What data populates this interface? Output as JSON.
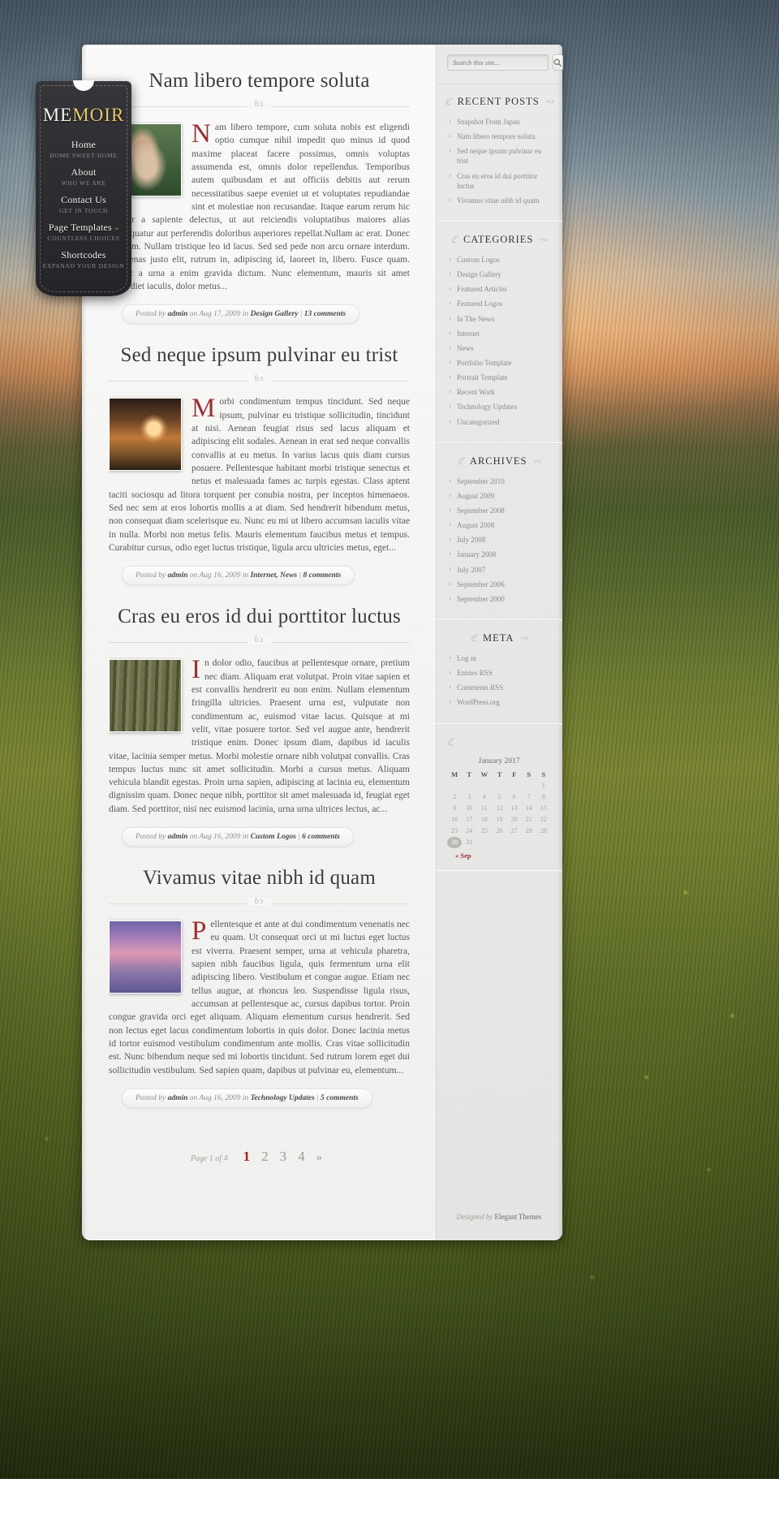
{
  "site": {
    "logo_prefix": "ME",
    "logo_suffix": "MOIR",
    "footer_credit_prefix": "Designed by ",
    "footer_credit_brand": "Elegant Themes"
  },
  "nav": [
    {
      "title": "Home",
      "sub": "HOME SWEET HOME",
      "arrow": false
    },
    {
      "title": "About",
      "sub": "WHO WE ARE",
      "arrow": false
    },
    {
      "title": "Contact Us",
      "sub": "GET IN TOUCH",
      "arrow": false
    },
    {
      "title": "Page Templates",
      "sub": "COUNTLESS CHOICES",
      "arrow": true
    },
    {
      "title": "Shortcodes",
      "sub": "EXPANAD YOUR DESIGN",
      "arrow": false
    }
  ],
  "search": {
    "placeholder": "Search this site...",
    "value": "",
    "icon": "magnifier-icon"
  },
  "posts": [
    {
      "title": "Nam libero tempore soluta",
      "divider_ornament": "ɓɔ",
      "dropcap": "N",
      "body": "am libero tempore, cum soluta nobis est eligendi optio cumque nihil impedit quo minus id quod maxime placeat facere possimus, omnis voluptas assumenda est, omnis dolor repellendus. Temporibus autem quibusdam et aut officiis debitis aut rerum necessitatibus saepe eveniet ut et voluptates repudiandae sint et molestiae non recusandae. Itaque earum rerum hic tenetur a sapiente delectus, ut aut reiciendis voluptatibus maiores alias consequatur aut perferendis doloribus asperiores repellat.Nullam ac erat. Donec a ipsum. Nullam tristique leo id lacus. Sed sed pede non arcu ornare interdum. Maecenas justo elit, rutrum in, adipiscing id, laoreet in, libero. Fusce quam. Donec a urna a enim gravida dictum. Nunc elementum, mauris sit amet imperdiet iaculis, dolor metus...",
      "meta_prefix": "Posted by ",
      "author": "admin",
      "meta_on": " on ",
      "date": "Aug 17, 2009",
      "meta_in": " in ",
      "category": "Design Gallery",
      "meta_sep": " | ",
      "comments": "13 comments",
      "thumb": "portrait-woman-forest"
    },
    {
      "title": "Sed neque ipsum pulvinar eu trist",
      "divider_ornament": "ɓɔ",
      "dropcap": "M",
      "body": "orbi condimentum tempus tincidunt. Sed neque ipsum, pulvinar eu tristique sollicitudin, tincidunt at nisi. Aenean feugiat risus sed lacus aliquam et adipiscing elit sodales. Aenean in erat sed neque convallis convallis at eu metus. In varius lacus quis diam cursus posuere. Pellentesque habitant morbi tristique senectus et netus et malesuada fames ac turpis egestas. Class aptent taciti sociosqu ad litora torquent per conubia nostra, per inceptos himenaeos. Sed nec sem at eros lobortis mollis a at diam. Sed hendrerit bibendum metus, non consequat diam scelerisque eu. Nunc eu mi ut libero accumsan iaculis vitae in nulla. Morbi non metus felis. Mauris elementum faucibus metus et tempus. Curabitur cursus, odio eget luctus tristique, ligula arcu ultricies metus, eget...",
      "meta_prefix": "Posted by ",
      "author": "admin",
      "meta_on": " on ",
      "date": "Aug 16, 2009",
      "meta_in": " in ",
      "category": "Internet, News",
      "meta_sep": " | ",
      "comments": "8 comments",
      "thumb": "sunrise-tree"
    },
    {
      "title": "Cras eu eros id dui porttitor luctus",
      "divider_ornament": "ɓɔ",
      "dropcap": "I",
      "body": "n dolor odio, faucibus at pellentesque ornare, pretium nec diam. Aliquam erat volutpat. Proin vitae sapien et est convallis hendrerit eu non enim. Nullam elementum fringilla ultricies. Praesent urna est, vulputate non condimentum ac, euismod vitae lacus. Quisque at mi velit, vitae posuere tortor. Sed vel augue ante, hendrerit tristique enim. Donec ipsum diam, dapibus id iaculis vitae, lacinia semper metus. Morbi molestie ornare nibh volutpat convallis. Cras tempus luctus nunc sit amet sollicitudin. Morbi a cursus metus. Aliquam vehicula blandit egestas. Proin urna sapien, adipiscing at lacinia eu, elementum dignissim quam. Donec neque nibh, porttitor sit amet malesuada id, feugiat eget diam. Sed porttitor, nisi nec euismod lacinia, urna urna ultrices lectus, ac...",
      "meta_prefix": "Posted by ",
      "author": "admin",
      "meta_on": " on ",
      "date": "Aug 16, 2009",
      "meta_in": " in ",
      "category": "Custom Logos",
      "meta_sep": " | ",
      "comments": "6 comments",
      "thumb": "bamboo-stalks"
    },
    {
      "title": "Vivamus vitae nibh id quam",
      "divider_ornament": "ɓɔ",
      "dropcap": "P",
      "body": "ellentesque et ante at dui condimentum venenatis nec eu quam. Ut consequat orci ut mi luctus eget luctus est viverra. Praesent semper, urna at vehicula pharetra, sapien nibh faucibus ligula, quis fermentum urna elit adipiscing libero. Vestibulum et congue augue. Etiam nec tellus augue, at rhoncus leo. Suspendisse ligula risus, accumsan at pellentesque ac, cursus dapibus tortor. Proin congue gravida orci eget aliquam. Aliquam elementum cursus hendrerit. Sed non lectus eget lacus condimentum lobortis in quis dolor. Donec lacinia metus id tortor euismod vestibulum condimentum ante mollis. Cras vitae sollicitudin est. Nunc bibendum neque sed mi lobortis tincidunt. Sed rutrum lorem eget dui sollicitudin vestibulum. Sed sapien quam, dapibus ut pulvinar eu, elementum...",
      "meta_prefix": "Posted by ",
      "author": "admin",
      "meta_on": " on ",
      "date": "Aug 16, 2009",
      "meta_in": " in ",
      "category": "Technology Updates",
      "meta_sep": " | ",
      "comments": "5 comments",
      "thumb": "bridge-sunset"
    }
  ],
  "pagination": {
    "page_of": "Page 1 of 4",
    "pages": [
      "1",
      "2",
      "3",
      "4"
    ],
    "active": "1",
    "next": "»"
  },
  "widgets": {
    "recent_posts": {
      "title": "RECENT POSTS",
      "items": [
        "Snapshot From Japan",
        "Nam libero tempore soluta",
        "Sed neque ipsum pulvinar eu trist",
        "Cras eu eros id dui porttitor luctus",
        "Vivamus vitae nibh id quam"
      ]
    },
    "categories": {
      "title": "CATEGORIES",
      "items": [
        "Custom Logos",
        "Design Gallery",
        "Featured Articles",
        "Featured Logos",
        "In The News",
        "Internet",
        "News",
        "Portfolio Template",
        "Portrait Template",
        "Recent Work",
        "Technology Updates",
        "Uncategorized"
      ]
    },
    "archives": {
      "title": "ARCHIVES",
      "items": [
        "September 2010",
        "August 2009",
        "September 2008",
        "August 2008",
        "July 2008",
        "January 2008",
        "July 2007",
        "September 2006",
        "September 2000"
      ]
    },
    "meta": {
      "title": "META",
      "items": [
        "Log in",
        "Entries RSS",
        "Comments RSS",
        "WordPress.org"
      ]
    },
    "calendar": {
      "caption": "January 2017",
      "weekdays": [
        "M",
        "T",
        "W",
        "T",
        "F",
        "S",
        "S"
      ],
      "weeks": [
        [
          "",
          "",
          "",
          "",
          "",
          "",
          "1"
        ],
        [
          "2",
          "3",
          "4",
          "5",
          "6",
          "7",
          "8"
        ],
        [
          "9",
          "10",
          "11",
          "12",
          "13",
          "14",
          "15"
        ],
        [
          "16",
          "17",
          "18",
          "19",
          "20",
          "21",
          "22"
        ],
        [
          "23",
          "24",
          "25",
          "26",
          "27",
          "28",
          "29"
        ],
        [
          "30",
          "31",
          "",
          "",
          "",
          "",
          ""
        ]
      ],
      "today": "30",
      "prev_link": "« Sep"
    }
  },
  "colors": {
    "accent_red": "#9d2f2f",
    "logo_gold": "#e8c96a",
    "text_body": "#585858",
    "widget_text": "#8a8a85"
  }
}
